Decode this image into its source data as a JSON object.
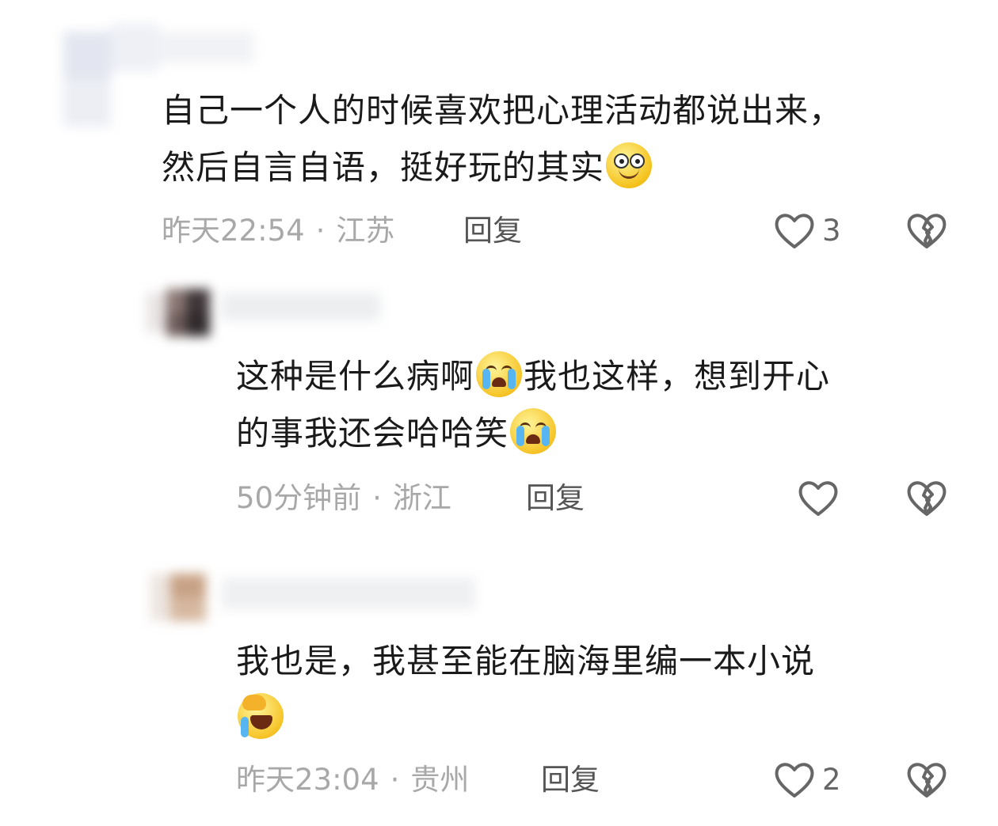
{
  "comments": [
    {
      "text_line1": "自己一个人的时候喜欢把心理活动都说出来，",
      "text_line2": "然后自言自语，挺好玩的其实",
      "emoji": "smile-emoji",
      "time": "昨天22:54",
      "separator": "·",
      "location": "江苏",
      "reply_label": "回复",
      "likes": "3"
    },
    {
      "text_line1": "这种是什么病啊",
      "text_line1b": "我也这样，想到开心",
      "text_line2": "的事我还会哈哈笑",
      "emoji": "crying-emoji",
      "time": "50分钟前",
      "separator": "·",
      "location": "浙江",
      "reply_label": "回复",
      "likes": ""
    },
    {
      "text_line1": "我也是，我甚至能在脑海里编一本小说",
      "emoji": "laughing-crying-emoji",
      "time": "昨天23:04",
      "separator": "·",
      "location": "贵州",
      "reply_label": "回复",
      "likes": "2"
    }
  ],
  "icons": {
    "like": "heart-outline-icon",
    "dislike": "broken-heart-icon"
  },
  "colors": {
    "text": "#1a1a1a",
    "meta": "#a8a8a8",
    "icon": "#666666"
  }
}
